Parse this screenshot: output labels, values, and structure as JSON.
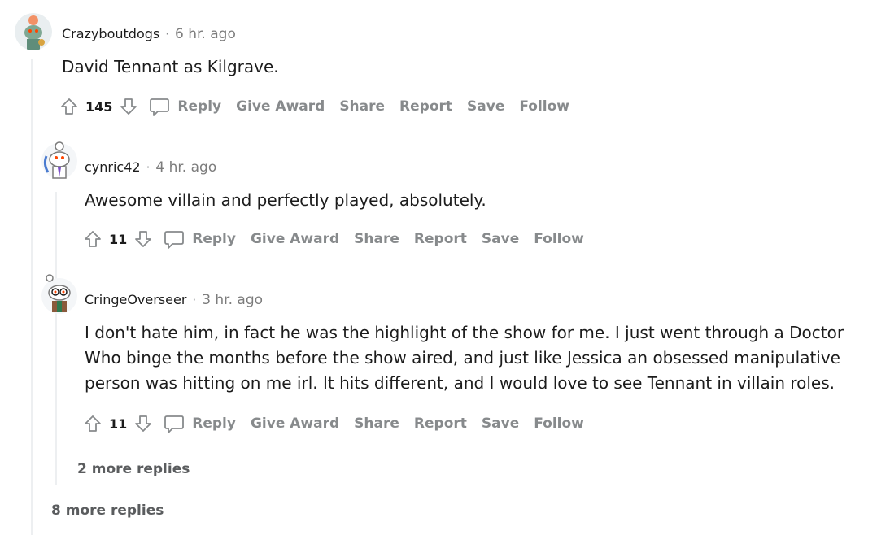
{
  "colors": {
    "thread_line": "#edeff1",
    "muted": "#878a8c",
    "text": "#1c1c1c"
  },
  "comments": [
    {
      "author": "Crazyboutdogs",
      "separator": "·",
      "time": "6 hr. ago",
      "body": "David Tennant as Kilgrave.",
      "score": "145",
      "actions": {
        "reply": "Reply",
        "award": "Give Award",
        "share": "Share",
        "report": "Report",
        "save": "Save",
        "follow": "Follow"
      }
    },
    {
      "author": "cynric42",
      "separator": "·",
      "time": "4 hr. ago",
      "body": "Awesome villain and perfectly played, absolutely.",
      "score": "11",
      "actions": {
        "reply": "Reply",
        "award": "Give Award",
        "share": "Share",
        "report": "Report",
        "save": "Save",
        "follow": "Follow"
      }
    },
    {
      "author": "CringeOverseer",
      "separator": "·",
      "time": "3 hr. ago",
      "body_lines": [
        "I don't hate him, in fact he was the highlight of the show for me. I just went through a Doctor",
        "Who binge the months before the show aired, and just like Jessica an obsessed manipulative",
        "person was hitting on me irl. It hits different, and I would love to see Tennant in villain roles."
      ],
      "score": "11",
      "actions": {
        "reply": "Reply",
        "award": "Give Award",
        "share": "Share",
        "report": "Report",
        "save": "Save",
        "follow": "Follow"
      }
    }
  ],
  "more_replies_nested": "2 more replies",
  "more_replies_top": "8 more replies"
}
